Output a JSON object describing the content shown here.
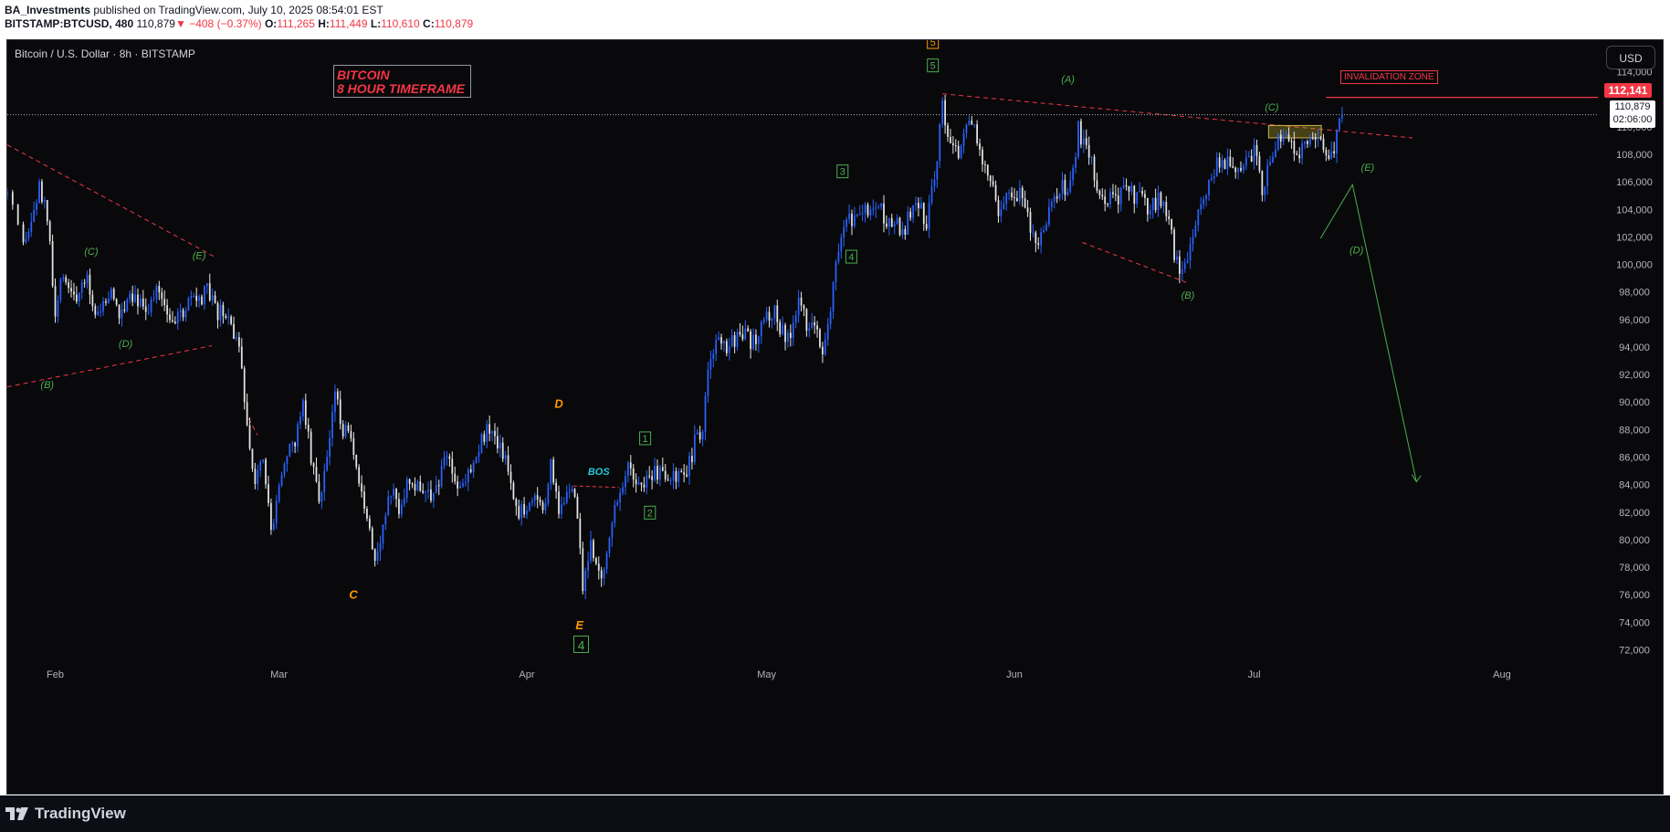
{
  "header": {
    "author": "BA_Investments",
    "published": "published on TradingView.com, July 10, 2025 08:54:01 EST",
    "symbol": "BITSTAMP:BTCUSD, 480",
    "last": "110,879",
    "change_arrow": "▼",
    "change": "−408 (−0.37%)",
    "o_label": "O:",
    "o": "111,265",
    "h_label": "H:",
    "h": "111,449",
    "l_label": "L:",
    "l": "110,610",
    "c_label": "C:",
    "c": "110,879"
  },
  "chart_title": "Bitcoin / U.S. Dollar · 8h · BITSTAMP",
  "currency_button": "USD",
  "title_box": {
    "line1": "BITCOIN",
    "line2": "8 HOUR TIMEFRAME"
  },
  "invalidation_label": "INVALIDATION ZONE",
  "price_tags": {
    "invalidation": "112,141",
    "last": "110,879",
    "countdown": "02:06:00"
  },
  "footer": {
    "brand": "TradingView"
  },
  "colors": {
    "background": "#09090b",
    "bull_candle": "#2962ff",
    "bear_candle": "#e6e6e6",
    "wave_green": "#4caf50",
    "wave_orange": "#ff9800",
    "trendline_red": "#f23645",
    "bos_cyan": "#26c6da"
  },
  "chart_data": {
    "type": "candlestick",
    "title": "Bitcoin / U.S. Dollar · 8h · BITSTAMP",
    "x_ticks": [
      {
        "label": "Feb",
        "day": 0
      },
      {
        "label": "Mar",
        "day": 28
      },
      {
        "label": "Apr",
        "day": 59
      },
      {
        "label": "May",
        "day": 89
      },
      {
        "label": "Jun",
        "day": 120
      },
      {
        "label": "Jul",
        "day": 150
      },
      {
        "label": "Aug",
        "day": 181
      }
    ],
    "x_range_days": [
      -6,
      193
    ],
    "y_ticks": [
      72000,
      74000,
      76000,
      78000,
      80000,
      82000,
      84000,
      86000,
      88000,
      90000,
      92000,
      94000,
      96000,
      98000,
      100000,
      102000,
      104000,
      106000,
      108000,
      110000,
      114000
    ],
    "ylim": [
      70900,
      116300
    ],
    "price_anchors": [
      {
        "day": -6,
        "price": 105000
      },
      {
        "day": -4,
        "price": 101000
      },
      {
        "day": -3,
        "price": 103000
      },
      {
        "day": -2,
        "price": 105500
      },
      {
        "day": -1,
        "price": 103500
      },
      {
        "day": 0,
        "price": 96000
      },
      {
        "day": 1,
        "price": 99500
      },
      {
        "day": 2,
        "price": 98000
      },
      {
        "day": 3,
        "price": 97500
      },
      {
        "day": 4,
        "price": 99000
      },
      {
        "day": 5,
        "price": 96500
      },
      {
        "day": 6,
        "price": 97000
      },
      {
        "day": 7,
        "price": 98000
      },
      {
        "day": 8,
        "price": 96200
      },
      {
        "day": 9,
        "price": 97800
      },
      {
        "day": 10,
        "price": 98000
      },
      {
        "day": 11,
        "price": 96800
      },
      {
        "day": 12,
        "price": 97200
      },
      {
        "day": 13,
        "price": 98200
      },
      {
        "day": 14,
        "price": 96800
      },
      {
        "day": 15,
        "price": 95800
      },
      {
        "day": 16,
        "price": 96500
      },
      {
        "day": 17,
        "price": 97500
      },
      {
        "day": 18,
        "price": 97000
      },
      {
        "day": 19,
        "price": 98200
      },
      {
        "day": 20,
        "price": 96500
      },
      {
        "day": 21,
        "price": 96300
      },
      {
        "day": 22,
        "price": 95800
      },
      {
        "day": 23,
        "price": 93500
      },
      {
        "day": 24,
        "price": 88500
      },
      {
        "day": 25,
        "price": 84500
      },
      {
        "day": 26,
        "price": 86500
      },
      {
        "day": 27,
        "price": 80500
      },
      {
        "day": 28,
        "price": 84500
      },
      {
        "day": 29,
        "price": 86000
      },
      {
        "day": 30,
        "price": 87000
      },
      {
        "day": 31,
        "price": 90500
      },
      {
        "day": 32,
        "price": 86000
      },
      {
        "day": 33,
        "price": 83000
      },
      {
        "day": 34,
        "price": 86000
      },
      {
        "day": 35,
        "price": 90500
      },
      {
        "day": 36,
        "price": 88000
      },
      {
        "day": 37,
        "price": 87000
      },
      {
        "day": 38,
        "price": 83500
      },
      {
        "day": 39,
        "price": 82000
      },
      {
        "day": 40,
        "price": 78800
      },
      {
        "day": 41,
        "price": 81000
      },
      {
        "day": 42,
        "price": 83500
      },
      {
        "day": 43,
        "price": 82500
      },
      {
        "day": 44,
        "price": 84000
      },
      {
        "day": 45,
        "price": 83500
      },
      {
        "day": 46,
        "price": 84000
      },
      {
        "day": 47,
        "price": 82500
      },
      {
        "day": 48,
        "price": 84500
      },
      {
        "day": 49,
        "price": 86500
      },
      {
        "day": 50,
        "price": 84200
      },
      {
        "day": 51,
        "price": 83800
      },
      {
        "day": 52,
        "price": 85500
      },
      {
        "day": 53,
        "price": 87000
      },
      {
        "day": 54,
        "price": 87800
      },
      {
        "day": 55,
        "price": 87000
      },
      {
        "day": 56,
        "price": 86500
      },
      {
        "day": 57,
        "price": 84200
      },
      {
        "day": 58,
        "price": 82200
      },
      {
        "day": 59,
        "price": 82500
      },
      {
        "day": 60,
        "price": 83000
      },
      {
        "day": 61,
        "price": 82300
      },
      {
        "day": 62,
        "price": 85300
      },
      {
        "day": 63,
        "price": 82000
      },
      {
        "day": 64,
        "price": 83600
      },
      {
        "day": 65,
        "price": 83300
      },
      {
        "day": 66,
        "price": 76800
      },
      {
        "day": 67,
        "price": 79500
      },
      {
        "day": 68,
        "price": 77500
      },
      {
        "day": 69,
        "price": 78500
      },
      {
        "day": 70,
        "price": 82500
      },
      {
        "day": 71,
        "price": 84500
      },
      {
        "day": 72,
        "price": 85500
      },
      {
        "day": 73,
        "price": 83800
      },
      {
        "day": 74,
        "price": 84500
      },
      {
        "day": 75,
        "price": 85000
      },
      {
        "day": 76,
        "price": 84700
      },
      {
        "day": 77,
        "price": 84200
      },
      {
        "day": 78,
        "price": 85000
      },
      {
        "day": 79,
        "price": 84600
      },
      {
        "day": 80,
        "price": 87000
      },
      {
        "day": 81,
        "price": 88000
      },
      {
        "day": 82,
        "price": 93500
      },
      {
        "day": 83,
        "price": 94500
      },
      {
        "day": 84,
        "price": 93800
      },
      {
        "day": 85,
        "price": 94500
      },
      {
        "day": 86,
        "price": 95000
      },
      {
        "day": 87,
        "price": 94200
      },
      {
        "day": 88,
        "price": 95000
      },
      {
        "day": 89,
        "price": 96500
      },
      {
        "day": 90,
        "price": 96500
      },
      {
        "day": 91,
        "price": 95000
      },
      {
        "day": 92,
        "price": 94500
      },
      {
        "day": 93,
        "price": 97200
      },
      {
        "day": 94,
        "price": 95500
      },
      {
        "day": 95,
        "price": 96000
      },
      {
        "day": 96,
        "price": 94000
      },
      {
        "day": 97,
        "price": 97000
      },
      {
        "day": 98,
        "price": 101500
      },
      {
        "day": 99,
        "price": 103500
      },
      {
        "day": 100,
        "price": 103300
      },
      {
        "day": 101,
        "price": 104000
      },
      {
        "day": 102,
        "price": 103500
      },
      {
        "day": 103,
        "price": 104500
      },
      {
        "day": 104,
        "price": 103000
      },
      {
        "day": 105,
        "price": 103500
      },
      {
        "day": 106,
        "price": 102500
      },
      {
        "day": 107,
        "price": 103500
      },
      {
        "day": 108,
        "price": 104500
      },
      {
        "day": 109,
        "price": 103000
      },
      {
        "day": 110,
        "price": 106500
      },
      {
        "day": 111,
        "price": 111500
      },
      {
        "day": 112,
        "price": 109000
      },
      {
        "day": 113,
        "price": 108000
      },
      {
        "day": 114,
        "price": 109500
      },
      {
        "day": 115,
        "price": 110500
      },
      {
        "day": 116,
        "price": 107500
      },
      {
        "day": 117,
        "price": 106500
      },
      {
        "day": 118,
        "price": 104000
      },
      {
        "day": 119,
        "price": 105000
      },
      {
        "day": 120,
        "price": 104300
      },
      {
        "day": 121,
        "price": 105500
      },
      {
        "day": 122,
        "price": 103000
      },
      {
        "day": 123,
        "price": 101500
      },
      {
        "day": 124,
        "price": 103500
      },
      {
        "day": 125,
        "price": 105000
      },
      {
        "day": 126,
        "price": 105500
      },
      {
        "day": 127,
        "price": 105800
      },
      {
        "day": 128,
        "price": 109800
      },
      {
        "day": 129,
        "price": 108500
      },
      {
        "day": 130,
        "price": 106500
      },
      {
        "day": 131,
        "price": 104500
      },
      {
        "day": 132,
        "price": 105000
      },
      {
        "day": 133,
        "price": 104500
      },
      {
        "day": 134,
        "price": 106300
      },
      {
        "day": 135,
        "price": 105000
      },
      {
        "day": 136,
        "price": 104600
      },
      {
        "day": 137,
        "price": 104000
      },
      {
        "day": 138,
        "price": 104800
      },
      {
        "day": 139,
        "price": 103500
      },
      {
        "day": 140,
        "price": 101000
      },
      {
        "day": 141,
        "price": 99000
      },
      {
        "day": 142,
        "price": 101500
      },
      {
        "day": 143,
        "price": 104500
      },
      {
        "day": 144,
        "price": 105500
      },
      {
        "day": 145,
        "price": 107000
      },
      {
        "day": 146,
        "price": 107500
      },
      {
        "day": 147,
        "price": 107000
      },
      {
        "day": 148,
        "price": 107200
      },
      {
        "day": 149,
        "price": 107500
      },
      {
        "day": 150,
        "price": 108500
      },
      {
        "day": 151,
        "price": 105500
      },
      {
        "day": 152,
        "price": 108000
      },
      {
        "day": 153,
        "price": 109500
      },
      {
        "day": 154,
        "price": 109000
      },
      {
        "day": 155,
        "price": 108400
      },
      {
        "day": 156,
        "price": 108100
      },
      {
        "day": 157,
        "price": 108600
      },
      {
        "day": 158,
        "price": 109300
      },
      {
        "day": 159,
        "price": 108200
      },
      {
        "day": 160,
        "price": 108700
      },
      {
        "day": 161,
        "price": 110879
      }
    ],
    "candles_per_day": 3,
    "annotations": [
      {
        "text": "(B)",
        "day": -1.0,
        "price": 91000,
        "color": "green"
      },
      {
        "text": "(C)",
        "day": 4.5,
        "price": 100700,
        "color": "green"
      },
      {
        "text": "(D)",
        "day": 8.8,
        "price": 94000,
        "color": "green"
      },
      {
        "text": "(E)",
        "day": 18.0,
        "price": 100400,
        "color": "green"
      },
      {
        "text": "C",
        "day": 37.3,
        "price": 75700,
        "color": "orange"
      },
      {
        "text": "D",
        "day": 63.0,
        "price": 89600,
        "color": "orange"
      },
      {
        "text": "E",
        "day": 65.6,
        "price": 73500,
        "color": "orange"
      },
      {
        "text": "BOS",
        "day": 68.0,
        "price": 84700,
        "color": "cyan"
      },
      {
        "text": "(A)",
        "day": 126.7,
        "price": 113200,
        "color": "green"
      },
      {
        "text": "(B)",
        "day": 141.7,
        "price": 97500,
        "color": "green"
      },
      {
        "text": "(C)",
        "day": 152.2,
        "price": 111200,
        "color": "green"
      },
      {
        "text": "(D)",
        "day": 162.8,
        "price": 100800,
        "color": "green"
      },
      {
        "text": "(E)",
        "day": 164.2,
        "price": 106800,
        "color": "green"
      }
    ],
    "boxed_labels": [
      {
        "text": "1",
        "day": 73.8,
        "price": 87100,
        "color": "green"
      },
      {
        "text": "2",
        "day": 74.4,
        "price": 81700,
        "color": "green"
      },
      {
        "text": "3",
        "day": 98.5,
        "price": 106500,
        "color": "green"
      },
      {
        "text": "4",
        "day": 99.6,
        "price": 100300,
        "color": "green"
      },
      {
        "text": "5",
        "day": 109.8,
        "price": 114200,
        "color": "green"
      },
      {
        "text": "5",
        "day": 109.8,
        "price": 115900,
        "color": "orange"
      },
      {
        "text": "4",
        "day": 65.8,
        "price": 72000,
        "color": "green"
      }
    ],
    "last_price": 110879,
    "invalidation_price": 112141
  }
}
